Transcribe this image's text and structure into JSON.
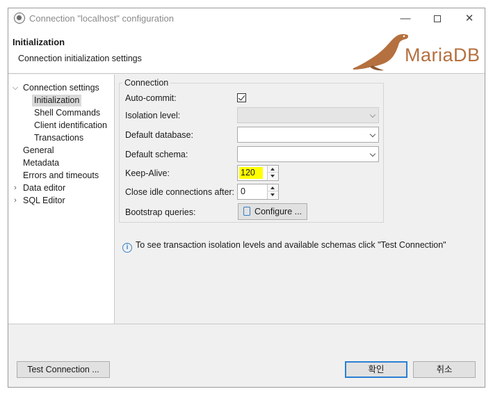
{
  "window": {
    "title": "Connection \"localhost\" configuration",
    "minimize_glyph": "—",
    "close_glyph": "✕"
  },
  "header": {
    "title": "Initialization",
    "subtitle": "Connection initialization settings",
    "logo_text": "MariaDB"
  },
  "nav": {
    "expanded_arrow": "⌵",
    "collapsed_arrow": "›",
    "items": [
      {
        "label": "Connection settings"
      },
      {
        "label": "Initialization"
      },
      {
        "label": "Shell Commands"
      },
      {
        "label": "Client identification"
      },
      {
        "label": "Transactions"
      },
      {
        "label": "General"
      },
      {
        "label": "Metadata"
      },
      {
        "label": "Errors and timeouts"
      },
      {
        "label": "Data editor"
      },
      {
        "label": "SQL Editor"
      }
    ]
  },
  "connection_group": {
    "legend": "Connection",
    "auto_commit": {
      "label": "Auto-commit:",
      "checked": true
    },
    "isolation_level": {
      "label": "Isolation level:",
      "value": ""
    },
    "default_database": {
      "label": "Default database:",
      "value": ""
    },
    "default_schema": {
      "label": "Default schema:",
      "value": ""
    },
    "keep_alive": {
      "label": "Keep-Alive:",
      "value": "120"
    },
    "close_idle": {
      "label": "Close idle connections after:",
      "value": "0"
    },
    "bootstrap": {
      "label": "Bootstrap queries:",
      "button_label": "Configure ..."
    }
  },
  "info": {
    "icon": "i",
    "text": "To see transaction isolation levels and available schemas click \"Test Connection\""
  },
  "footer": {
    "test_connection_label": "Test Connection ...",
    "ok_label": "확인",
    "cancel_label": "취소"
  },
  "colors": {
    "highlight": "#ffff00",
    "accent": "#2a7fd4",
    "logo": "#b5703f"
  }
}
